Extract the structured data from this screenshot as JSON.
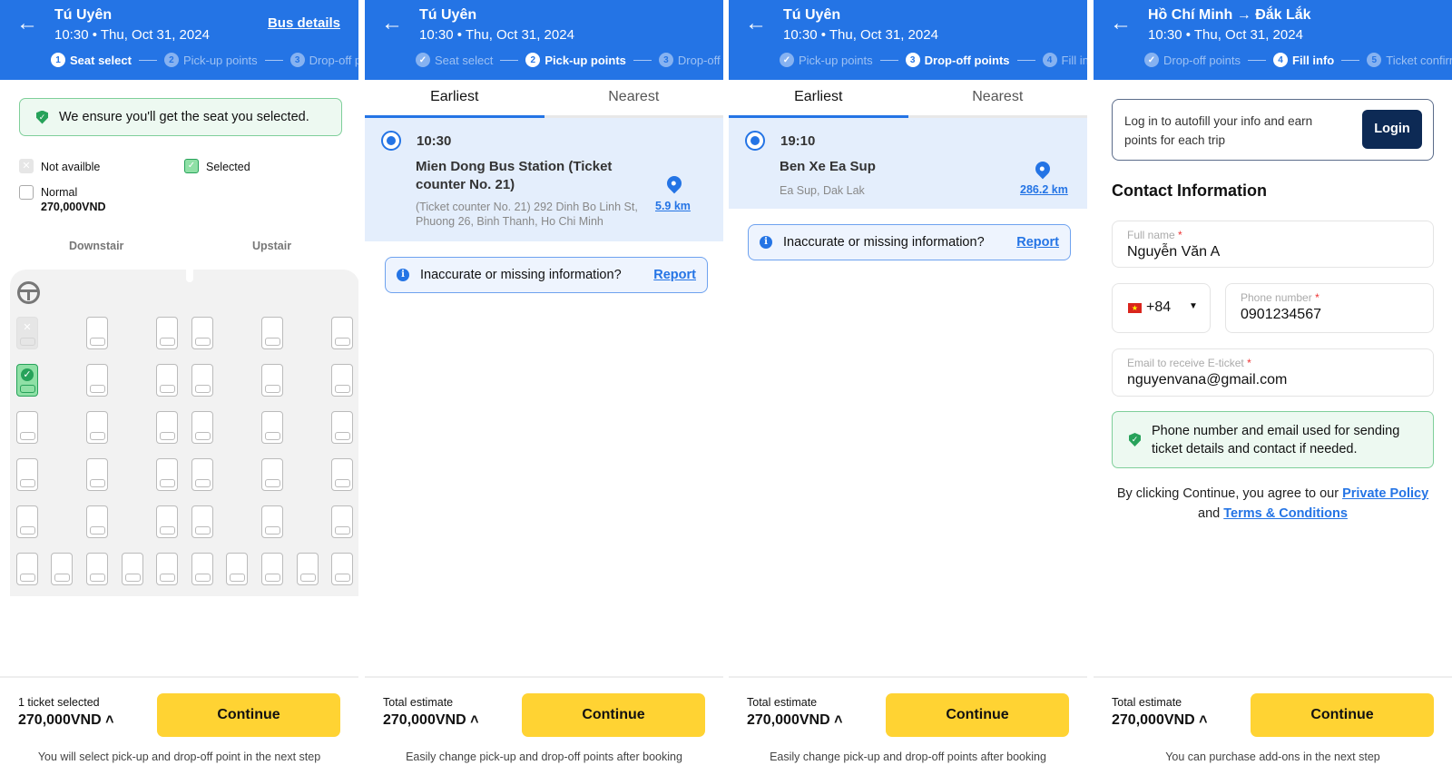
{
  "colors": {
    "brand": "#2474e5",
    "cta": "#ffd333",
    "success": "#27a25a"
  },
  "panels": [
    {
      "header": {
        "title": "Tú Uyên",
        "subtitle": "10:30 • Thu, Oct 31, 2024",
        "bus_details": "Bus details",
        "steps": [
          {
            "num": "1",
            "label": "Seat select",
            "state": "active"
          },
          {
            "num": "2",
            "label": "Pick-up points",
            "state": "todo"
          },
          {
            "num": "3",
            "label": "Drop-off p",
            "state": "todo"
          }
        ]
      },
      "guarantee": "We ensure you'll get the seat you selected.",
      "legend": {
        "not_available": "Not availble",
        "selected": "Selected",
        "normal": "Normal",
        "normal_price": "270,000VND"
      },
      "decks": {
        "downstair": "Downstair",
        "upstair": "Upstair"
      },
      "seats": [
        [
          "unavailable",
          "normal",
          "normal",
          "normal",
          "normal",
          "normal"
        ],
        [
          "selected",
          "normal",
          "normal",
          "normal",
          "normal",
          "normal"
        ],
        [
          "normal",
          "normal",
          "normal",
          "normal",
          "normal",
          "normal"
        ],
        [
          "normal",
          "normal",
          "normal",
          "normal",
          "normal",
          "normal"
        ],
        [
          "normal",
          "normal",
          "normal",
          "normal",
          "normal",
          "normal"
        ],
        [
          "normal",
          "normal",
          "normal",
          "normal",
          "normal",
          "normal",
          "normal",
          "normal",
          "normal",
          "normal"
        ]
      ],
      "footer": {
        "label": "1 ticket selected",
        "price": "270,000VND",
        "continue": "Continue",
        "note": "You will select pick-up and drop-off point in the next step"
      }
    },
    {
      "header": {
        "title": "Tú Uyên",
        "subtitle": "10:30 • Thu, Oct 31, 2024",
        "steps": [
          {
            "num": "✓",
            "label": "Seat select",
            "state": "done"
          },
          {
            "num": "2",
            "label": "Pick-up points",
            "state": "active"
          },
          {
            "num": "3",
            "label": "Drop-off p",
            "state": "todo"
          }
        ]
      },
      "tabs": [
        "Earliest",
        "Nearest"
      ],
      "item": {
        "time": "10:30",
        "name": "Mien Dong Bus Station (Ticket counter No. 21)",
        "address": "(Ticket counter No. 21) 292 Dinh Bo Linh St, Phuong 26, Binh Thanh, Ho Chi Minh",
        "distance": "5.9 km"
      },
      "report": {
        "text": "Inaccurate or missing information?",
        "link": "Report"
      },
      "footer": {
        "label": "Total estimate",
        "price": "270,000VND",
        "continue": "Continue",
        "note": "Easily change pick-up and drop-off points after booking"
      }
    },
    {
      "header": {
        "title": "Tú Uyên",
        "subtitle": "10:30 • Thu, Oct 31, 2024",
        "steps": [
          {
            "num": "✓",
            "label": "Pick-up points",
            "state": "done"
          },
          {
            "num": "3",
            "label": "Drop-off points",
            "state": "active"
          },
          {
            "num": "4",
            "label": "Fill inf",
            "state": "todo"
          }
        ]
      },
      "tabs": [
        "Earliest",
        "Nearest"
      ],
      "item": {
        "time": "19:10",
        "name": "Ben Xe Ea Sup",
        "address": "Ea Sup, Dak Lak",
        "distance": "286.2 km"
      },
      "report": {
        "text": "Inaccurate or missing information?",
        "link": "Report"
      },
      "footer": {
        "label": "Total estimate",
        "price": "270,000VND",
        "continue": "Continue",
        "note": "Easily change pick-up and drop-off points after booking"
      }
    },
    {
      "header": {
        "title": "Hồ Chí Minh → Đắk Lắk",
        "subtitle": "10:30 • Thu, Oct 31, 2024",
        "steps": [
          {
            "num": "✓",
            "label": "Drop-off points",
            "state": "done"
          },
          {
            "num": "4",
            "label": "Fill info",
            "state": "active"
          },
          {
            "num": "5",
            "label": "Ticket confirm",
            "state": "todo"
          }
        ]
      },
      "login": {
        "text": "Log in to autofill your info and earn points for each trip",
        "button": "Login"
      },
      "section_title": "Contact Information",
      "fields": {
        "full_name": {
          "label": "Full name",
          "value": "Nguyễn Văn A"
        },
        "country_code": "+84",
        "phone": {
          "label": "Phone number",
          "value": "0901234567"
        },
        "email": {
          "label": "Email to receive E-ticket",
          "value": "nguyenvana@gmail.com"
        },
        "required_mark": "*"
      },
      "notice": "Phone number and email used for sending ticket details and contact if needed.",
      "agree": {
        "prefix": "By clicking Continue, you agree to our",
        "policy": "Private Policy",
        "and": "and",
        "terms": "Terms & Conditions"
      },
      "footer": {
        "label": "Total estimate",
        "price": "270,000VND",
        "continue": "Continue",
        "note": "You can purchase add-ons in the next step"
      }
    }
  ]
}
